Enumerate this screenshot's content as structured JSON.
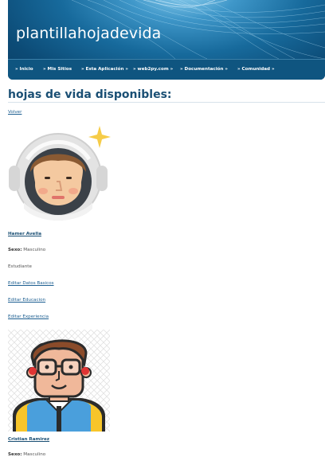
{
  "header": {
    "site_title": "plantillahojadevida",
    "nav": [
      {
        "label": "» Inicio"
      },
      {
        "label": "» Mis Sitios"
      },
      {
        "label": "» Esta Aplicación »"
      },
      {
        "label": "» web2py.com »"
      },
      {
        "label": "» Documentación »"
      },
      {
        "label": "» Comunidad »"
      }
    ]
  },
  "main": {
    "heading": "hojas de vida disponibles:",
    "back_link": "Volver",
    "profiles": [
      {
        "name": "Hamer Avella",
        "sexo_label": "Sexo:",
        "sexo_value": "Masculino",
        "role": "Estudiante",
        "actions": {
          "datos": "Editar Datos Basicos",
          "educacion": "Editar Educacion",
          "experiencia": "Editar Experiencia"
        }
      },
      {
        "name": "Cristian Ramirez",
        "sexo_label": "Sexo:",
        "sexo_value": "Masculino"
      }
    ]
  },
  "colors": {
    "header_blue": "#0c4b76",
    "navbar_blue": "#0f5580",
    "link_blue": "#1d5f91",
    "heading_blue": "#1a4f74"
  }
}
